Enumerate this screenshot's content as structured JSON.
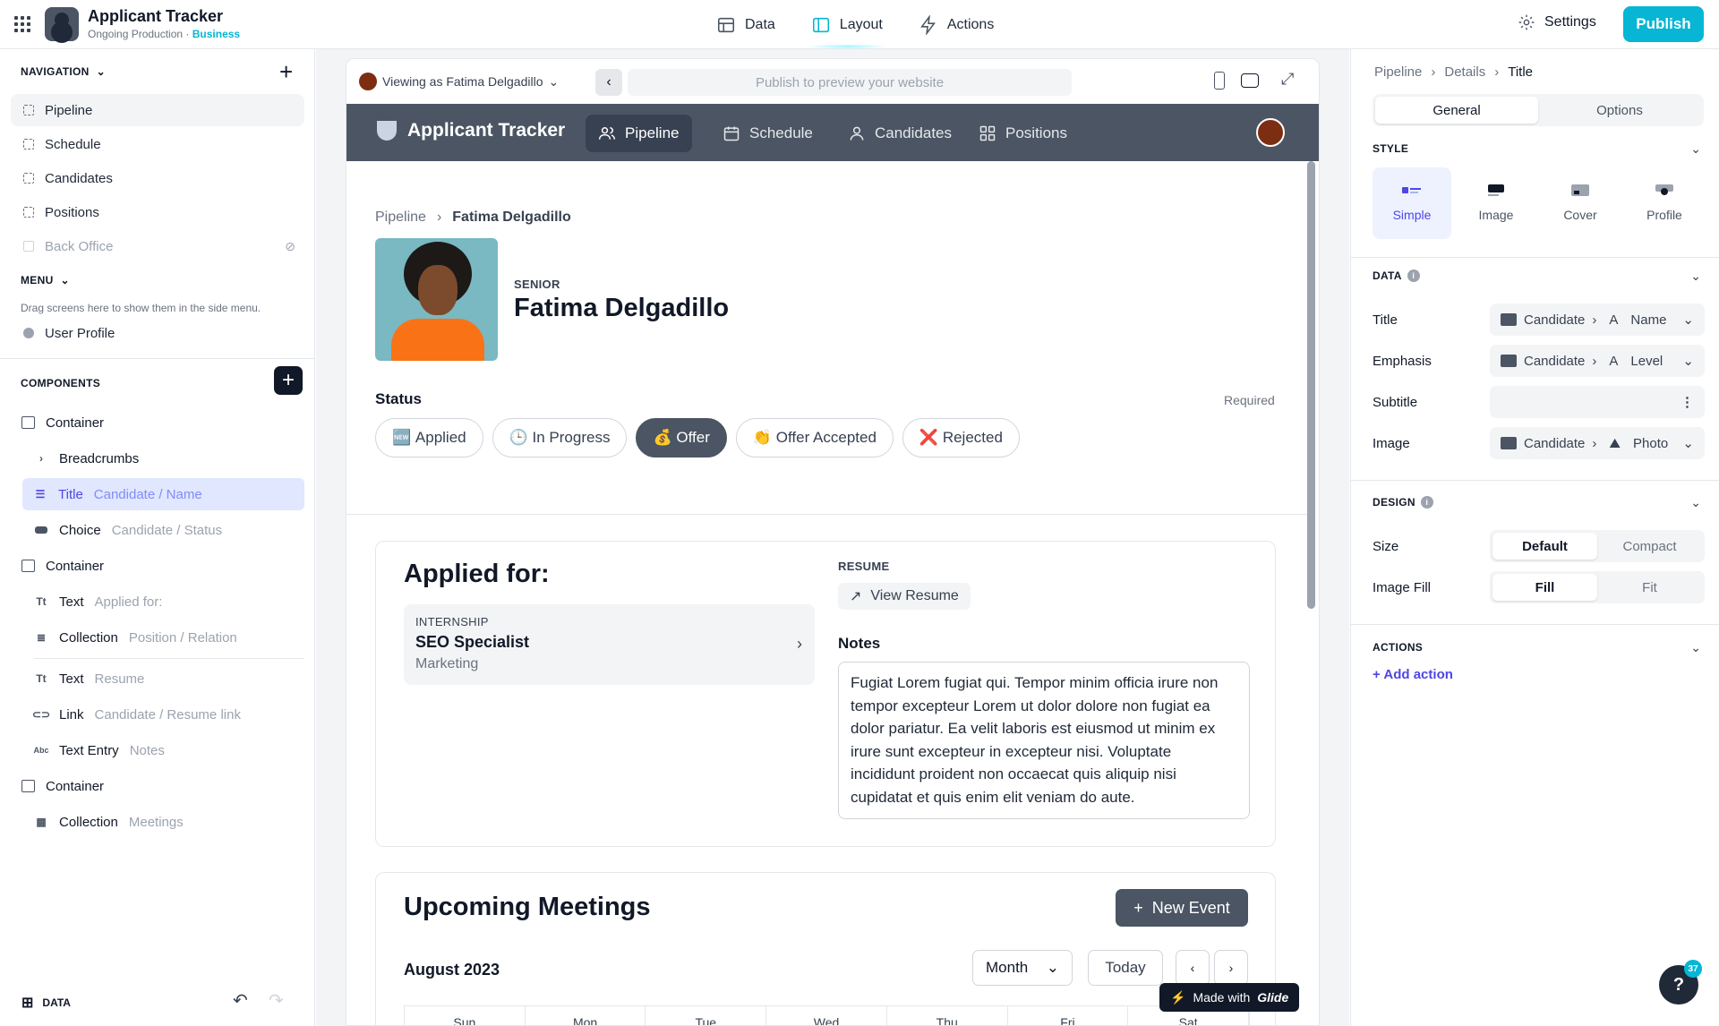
{
  "topbar": {
    "title": "Applicant Tracker",
    "subtitle": "Ongoing Production",
    "plan": "Business",
    "tabs": [
      {
        "label": "Data"
      },
      {
        "label": "Layout"
      },
      {
        "label": "Actions"
      }
    ],
    "settings_label": "Settings",
    "publish_label": "Publish"
  },
  "left": {
    "navigation_header": "NAVIGATION",
    "nav_items": [
      "Pipeline",
      "Schedule",
      "Candidates",
      "Positions",
      "Back Office"
    ],
    "menu_header": "MENU",
    "menu_hint": "Drag screens here to show them in the side menu.",
    "menu_items": [
      "User Profile"
    ],
    "components_header": "COMPONENTS",
    "components": [
      {
        "kind": "Container",
        "value": ""
      },
      {
        "kind": "Breadcrumbs",
        "value": ""
      },
      {
        "kind": "Title",
        "value": "Candidate / Name"
      },
      {
        "kind": "Choice",
        "value": "Candidate / Status"
      },
      {
        "kind": "Container",
        "value": ""
      },
      {
        "kind": "Text",
        "value": "Applied for:"
      },
      {
        "kind": "Collection",
        "value": "Position / Relation"
      },
      {
        "kind": "Text",
        "value": "Resume"
      },
      {
        "kind": "Link",
        "value": "Candidate / Resume link"
      },
      {
        "kind": "Text Entry",
        "value": "Notes"
      },
      {
        "kind": "Container",
        "value": ""
      },
      {
        "kind": "Collection",
        "value": "Meetings"
      }
    ],
    "bottom_label": "DATA"
  },
  "preview": {
    "viewing_as": "Viewing as Fatima Delgadillo",
    "url_placeholder": "Publish to preview your website",
    "app_name": "Applicant Tracker",
    "nav": [
      "Pipeline",
      "Schedule",
      "Candidates",
      "Positions"
    ],
    "breadcrumb": [
      "Pipeline",
      "Fatima Delgadillo"
    ],
    "emphasis": "SENIOR",
    "title": "Fatima Delgadillo",
    "status_label": "Status",
    "required": "Required",
    "status_options": [
      {
        "icon": "🆕",
        "label": "Applied"
      },
      {
        "icon": "🕒",
        "label": "In Progress"
      },
      {
        "icon": "💰",
        "label": "Offer"
      },
      {
        "icon": "👏",
        "label": "Offer Accepted"
      },
      {
        "icon": "❌",
        "label": "Rejected"
      }
    ],
    "selected_status": "Offer",
    "applied_for": "Applied for:",
    "position": {
      "emphasis": "INTERNSHIP",
      "title": "SEO Specialist",
      "subtitle": "Marketing"
    },
    "resume_label": "RESUME",
    "resume_link": "View Resume",
    "notes_label": "Notes",
    "notes_text": "Fugiat Lorem fugiat qui. Tempor minim officia irure non tempor excepteur Lorem ut dolor dolore non fugiat ea dolor pariatur. Ea velit laboris est eiusmod ut minim ex irure sunt excepteur in excepteur nisi. Voluptate incididunt proident non occaecat quis aliquip nisi cupidatat et quis enim elit veniam do aute.",
    "meetings_title": "Upcoming Meetings",
    "new_event": "New Event",
    "month_label": "August 2023",
    "view_select": "Month",
    "today": "Today",
    "weekdays": [
      "Sun",
      "Mon",
      "Tue",
      "Wed",
      "Thu",
      "Fri",
      "Sat"
    ],
    "made_with": "Made with",
    "glide": "Glide"
  },
  "right": {
    "breadcrumb": [
      "Pipeline",
      "Details",
      "Title"
    ],
    "tabs": [
      "General",
      "Options"
    ],
    "style_header": "STYLE",
    "styles": [
      "Simple",
      "Image",
      "Cover",
      "Profile"
    ],
    "data_header": "DATA",
    "rows": [
      {
        "label": "Title",
        "source": "Candidate",
        "type": "A",
        "field": "Name"
      },
      {
        "label": "Emphasis",
        "source": "Candidate",
        "type": "A",
        "field": "Level"
      },
      {
        "label": "Subtitle",
        "source": "",
        "type": "",
        "field": ""
      },
      {
        "label": "Image",
        "source": "Candidate",
        "type": "img",
        "field": "Photo"
      }
    ],
    "design_header": "DESIGN",
    "size_label": "Size",
    "size_options": [
      "Default",
      "Compact"
    ],
    "fill_label": "Image Fill",
    "fill_options": [
      "Fill",
      "Fit"
    ],
    "actions_header": "ACTIONS",
    "add_action": "Add action",
    "help_badge": "37",
    "help_icon": "?"
  },
  "colors": {
    "accent": "#06b6d4",
    "primary": "#4f46e5",
    "appbar": "#4b5563"
  }
}
